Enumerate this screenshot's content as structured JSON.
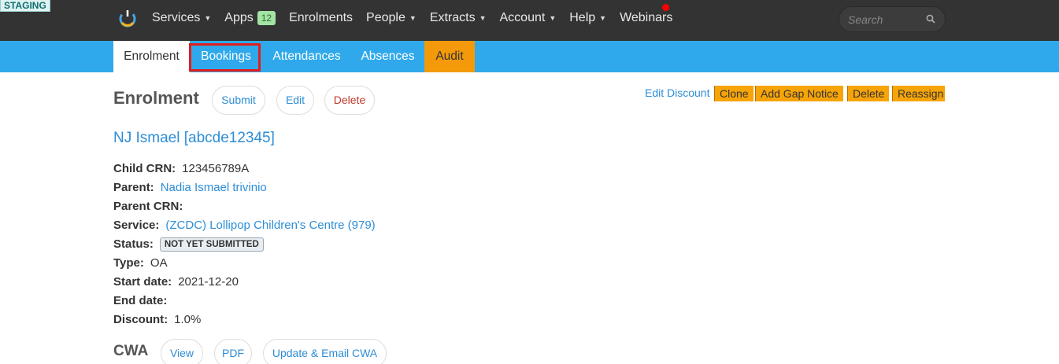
{
  "env_label": "STAGING",
  "topnav": {
    "items": [
      {
        "label": "Services",
        "dropdown": true
      },
      {
        "label": "Apps",
        "badge": "12"
      },
      {
        "label": "Enrolments"
      },
      {
        "label": "People",
        "dropdown": true
      },
      {
        "label": "Extracts",
        "dropdown": true
      },
      {
        "label": "Account",
        "dropdown": true
      },
      {
        "label": "Help",
        "dropdown": true
      },
      {
        "label": "Webinars"
      }
    ],
    "search_placeholder": "Search"
  },
  "tabs": {
    "enrolment": "Enrolment",
    "bookings": "Bookings",
    "attendances": "Attendances",
    "absences": "Absences",
    "audit": "Audit"
  },
  "enrolment": {
    "heading": "Enrolment",
    "submit": "Submit",
    "edit": "Edit",
    "delete": "Delete",
    "edit_discount": "Edit Discount",
    "clone": "Clone",
    "add_gap_notice": "Add Gap Notice",
    "delete2": "Delete",
    "reassign": "Reassign"
  },
  "child_name": "NJ Ismael [abcde12345]",
  "details": {
    "child_crn_label": "Child CRN:",
    "child_crn": "123456789A",
    "parent_label": "Parent:",
    "parent": "Nadia Ismael trivinio",
    "parent_crn_label": "Parent CRN:",
    "parent_crn": "",
    "service_label": "Service:",
    "service": "(ZCDC) Lollipop Children's Centre (979)",
    "status_label": "Status:",
    "status": "NOT YET SUBMITTED",
    "type_label": "Type:",
    "type": "OA",
    "start_label": "Start date:",
    "start": "2021-12-20",
    "end_label": "End date:",
    "end": "",
    "discount_label": "Discount:",
    "discount": "1.0%"
  },
  "cwa": {
    "heading": "CWA",
    "view": "View",
    "pdf": "PDF",
    "update_email": "Update & Email CWA"
  },
  "colors": {
    "topbar": "#333333",
    "subnav": "#2fa9ec",
    "audit": "#f49a0a",
    "orange_buttons": "#f6a408",
    "link": "#2d8dd6",
    "highlight": "#e11d1d"
  }
}
